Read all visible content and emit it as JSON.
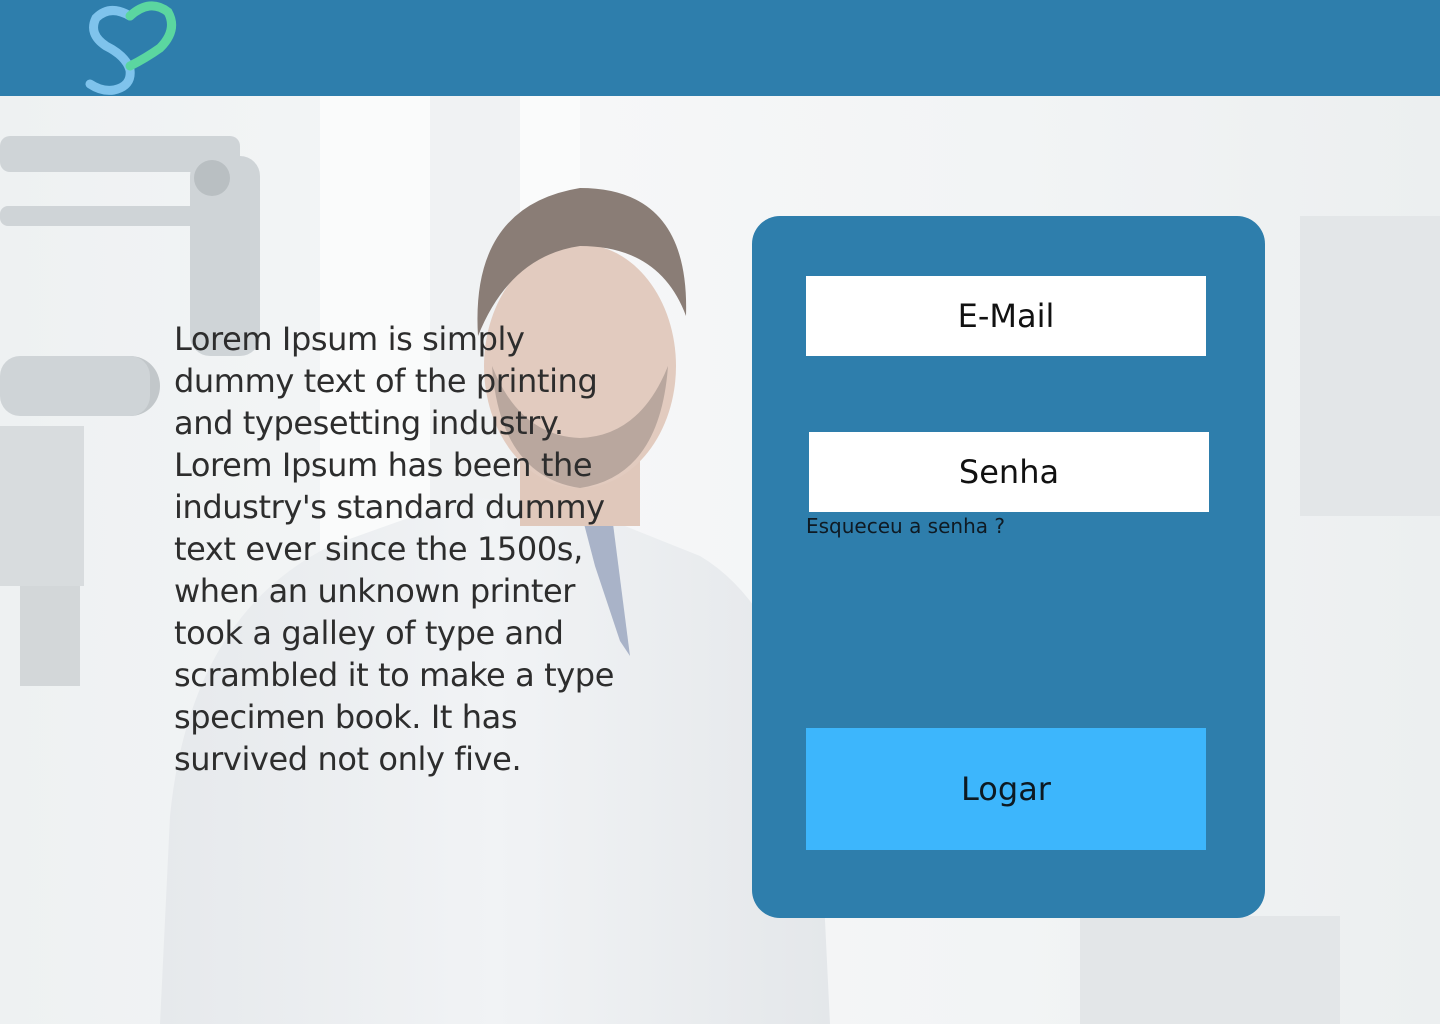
{
  "header": {
    "logo_colors": {
      "primary": "#3db6fc",
      "secondary": "#5bd6a0"
    },
    "background": "#2e7eac"
  },
  "hero": {
    "intro_text": "Lorem Ipsum is simply dummy text of the printing and typesetting industry. Lorem Ipsum has been the industry's standard dummy text ever since the 1500s, when an unknown printer took a galley of type and scrambled it to make a type specimen book. It has survived not only five."
  },
  "login": {
    "email_placeholder": "E-Mail",
    "password_placeholder": "Senha",
    "forgot_password_label": "Esqueceu a senha ?",
    "submit_label": "Logar",
    "card_color": "#2e7eac",
    "button_color": "#3db6fc"
  }
}
